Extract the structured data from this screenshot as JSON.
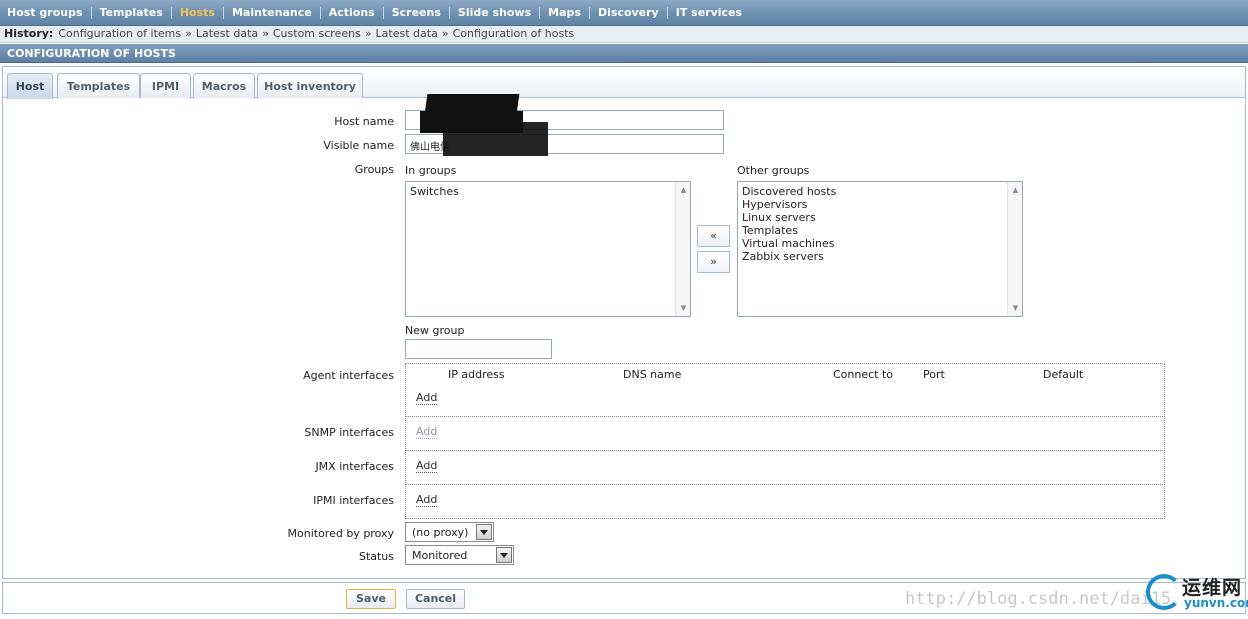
{
  "menu": {
    "items": [
      {
        "label": "Host groups",
        "name": "menu-host-groups",
        "active": false
      },
      {
        "label": "Templates",
        "name": "menu-templates",
        "active": false
      },
      {
        "label": "Hosts",
        "name": "menu-hosts",
        "active": true
      },
      {
        "label": "Maintenance",
        "name": "menu-maintenance",
        "active": false
      },
      {
        "label": "Actions",
        "name": "menu-actions",
        "active": false
      },
      {
        "label": "Screens",
        "name": "menu-screens",
        "active": false
      },
      {
        "label": "Slide shows",
        "name": "menu-slide-shows",
        "active": false
      },
      {
        "label": "Maps",
        "name": "menu-maps",
        "active": false
      },
      {
        "label": "Discovery",
        "name": "menu-discovery",
        "active": false
      },
      {
        "label": "IT services",
        "name": "menu-it-services",
        "active": false
      }
    ]
  },
  "history": {
    "label": "History:",
    "separator": "»",
    "crumbs": [
      "Configuration of items",
      "Latest data",
      "Custom screens",
      "Latest data",
      "Configuration of hosts"
    ]
  },
  "header": {
    "title": "CONFIGURATION OF HOSTS"
  },
  "tabs": [
    "Host",
    "Templates",
    "IPMI",
    "Macros",
    "Host inventory"
  ],
  "form": {
    "host_name_label": "Host name",
    "host_name_value": "",
    "visible_name_label": "Visible name",
    "visible_name_value": "佛山电信",
    "groups_label": "Groups",
    "in_groups_label": "In groups",
    "in_groups": [
      "Switches"
    ],
    "other_groups_label": "Other groups",
    "other_groups": [
      "Discovered hosts",
      "Hypervisors",
      "Linux servers",
      "Templates",
      "Virtual machines",
      "Zabbix servers"
    ],
    "move_left": "«",
    "move_right": "»",
    "new_group_label": "New group",
    "new_group_value": "",
    "agent_label": "Agent interfaces",
    "columns": [
      "IP address",
      "DNS name",
      "Connect to",
      "Port",
      "Default"
    ],
    "add_label": "Add",
    "snmp_label": "SNMP interfaces",
    "jmx_label": "JMX interfaces",
    "ipmi_label": "IPMI interfaces",
    "proxy_label": "Monitored by proxy",
    "proxy_value": "(no proxy)",
    "status_label": "Status",
    "status_value": "Monitored"
  },
  "footer": {
    "save": "Save",
    "cancel": "Cancel"
  },
  "watermark": {
    "text": "http://blog.csdn.net/dai15"
  },
  "logo": {
    "cn": "运维网",
    "en": "yunvn.com"
  }
}
